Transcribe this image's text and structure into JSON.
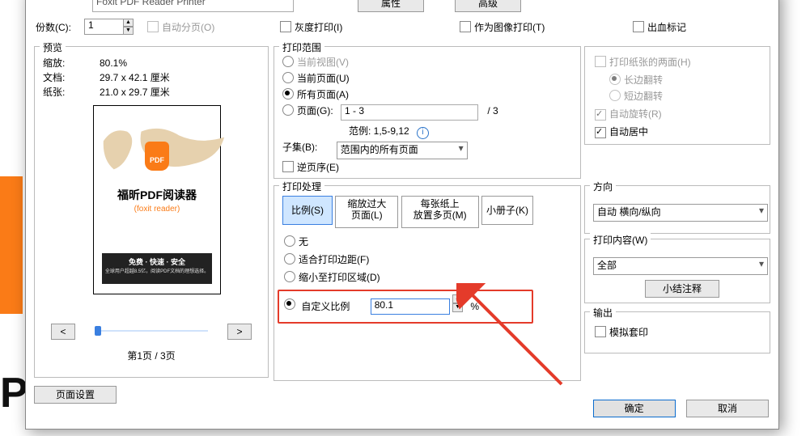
{
  "top": {
    "printer_name": "Foxit PDF Reader Printer",
    "prop_btn": "属性",
    "adv_btn": "高级"
  },
  "copies": {
    "label": "份数(C):",
    "value": "1",
    "auto_page": "自动分页(O)",
    "gray_print": "灰度打印(I)",
    "as_image": "作为图像打印(T)",
    "bleed": "出血标记"
  },
  "preview": {
    "title": "预览",
    "zoom_label": "缩放:",
    "zoom_value": "80.1%",
    "doc_label": "文档:",
    "doc_value": "29.7 x 42.1 厘米",
    "paper_label": "纸张:",
    "paper_value": "21.0 x 29.7 厘米",
    "page_title": "福昕PDF阅读器",
    "page_sub": "(foxit reader)",
    "band1": "免费 · 快速 · 安全",
    "band2": "全球用户超越8.5亿，阅读PDF文档的理想选择。",
    "nav_prev": "<",
    "nav_next": ">",
    "page_count": "第1页 / 3页"
  },
  "page_setup_btn": "页面设置",
  "range": {
    "title": "打印范围",
    "current_view": "当前视图(V)",
    "current_page": "当前页面(U)",
    "all_pages": "所有页面(A)",
    "pages": "页面(G):",
    "pages_value": "1 - 3",
    "pages_total": "/ 3",
    "example": "范例: 1,5-9,12",
    "subset_label": "子集(B):",
    "subset_value": "范围内的所有页面",
    "reverse": "逆页序(E)"
  },
  "duplex": {
    "both_sides": "打印纸张的两面(H)",
    "long_edge": "长边翻转",
    "short_edge": "短边翻转",
    "auto_rotate": "自动旋转(R)",
    "auto_center": "自动居中"
  },
  "handling": {
    "title": "打印处理",
    "tab_scale": "比例(S)",
    "tab_fit": "缩放过大\n页面(L)",
    "tab_multi": "每张纸上\n放置多页(M)",
    "tab_booklet": "小册子(K)",
    "none": "无",
    "fit_margins": "适合打印边距(F)",
    "shrink": "缩小至打印区域(D)",
    "custom_scale": "自定义比例",
    "custom_value": "80.1",
    "percent": "%"
  },
  "orientation": {
    "title": "方向",
    "value": "自动 横向/纵向"
  },
  "content": {
    "title": "打印内容(W)",
    "value": "全部",
    "summary_btn": "小结注释"
  },
  "output": {
    "title": "输出",
    "simulate": "模拟套印"
  },
  "footer": {
    "ok": "确定",
    "cancel": "取消"
  }
}
